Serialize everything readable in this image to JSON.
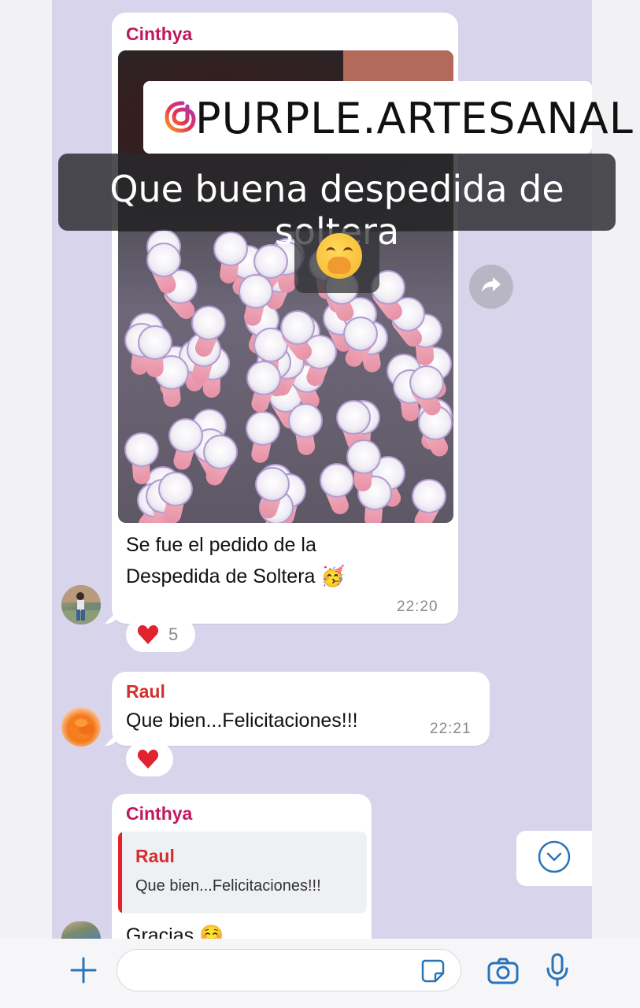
{
  "chat": {
    "message1": {
      "sender": "Cinthya",
      "text_line1": "Se fue el pedido de la",
      "text_line2": "Despedida de Soltera",
      "text_emoji": "🥳",
      "time": "22:20",
      "reaction": {
        "emoji": "heart",
        "count": "5"
      }
    },
    "message2": {
      "sender": "Raul",
      "text": "Que bien...Felicitaciones!!!",
      "time": "22:21",
      "reaction": {
        "emoji": "heart"
      }
    },
    "message3": {
      "sender": "Cinthya",
      "quote_sender": "Raul",
      "quote_text": "Que bien...Felicitaciones!!!",
      "text": "Gracias ☺️"
    }
  },
  "overlay": {
    "instagram_handle": "PURPLE.ARTESANAL",
    "caption": "Que buena despedida de soltera",
    "caption_emoji": "face-with-hand-over-mouth"
  },
  "colors": {
    "chat_background": "#d8d4ec",
    "sender_cinthya": "#c2185b",
    "sender_raul": "#d32f2f",
    "accent": "#2a74b6",
    "heart": "#e0232e"
  },
  "icons": [
    "share-icon",
    "chevron-down-icon",
    "plus-icon",
    "sticker-icon",
    "camera-icon",
    "microphone-icon",
    "instagram-icon"
  ]
}
